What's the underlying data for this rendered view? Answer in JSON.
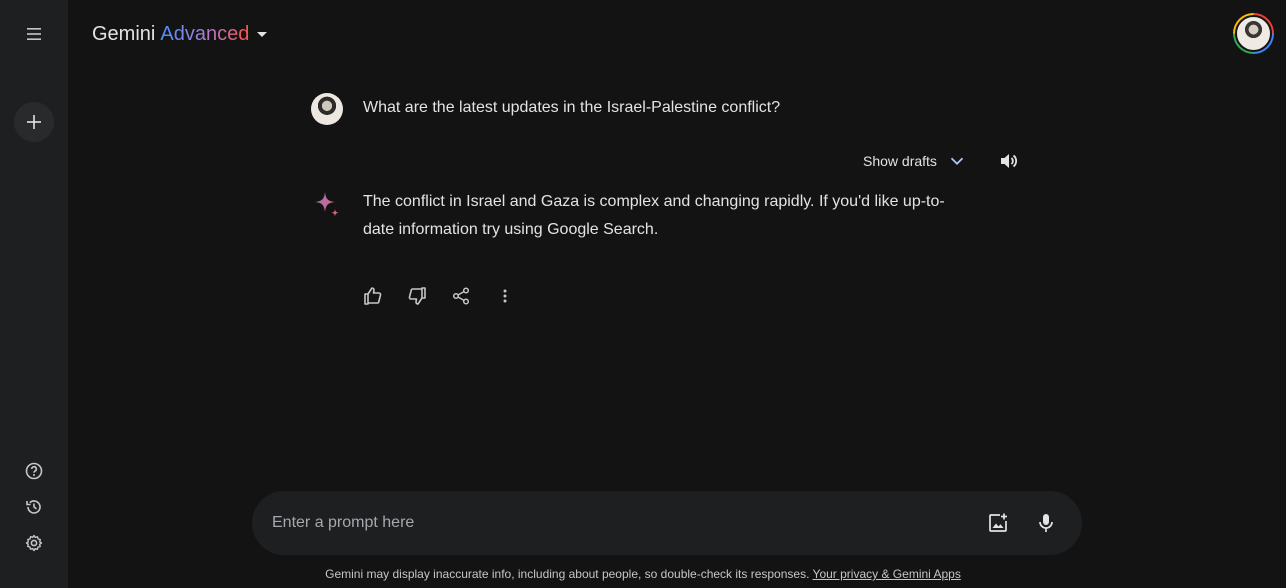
{
  "header": {
    "title_main": "Gemini",
    "title_accent": "Advanced"
  },
  "sidebar": {
    "menu_icon": "hamburger-menu-icon",
    "new_chat_icon": "plus-icon",
    "bottom_icons": [
      "help-icon",
      "history-icon",
      "settings-icon"
    ]
  },
  "conversation": {
    "user_query": "What are the latest updates in the Israel-Palestine conflict?",
    "show_drafts_label": "Show drafts",
    "response_text": "The conflict in Israel and Gaza is complex and changing rapidly. If you'd like up-to-date information try using Google Search.",
    "action_icons": [
      "thumbs-up-icon",
      "thumbs-down-icon",
      "share-icon",
      "more-vert-icon"
    ]
  },
  "prompt": {
    "placeholder": "Enter a prompt here"
  },
  "footer": {
    "disclaimer": "Gemini may display inaccurate info, including about people, so double-check its responses.",
    "privacy_link": "Your privacy & Gemini Apps"
  },
  "colors": {
    "background": "#131314",
    "sidebar": "#1e1f20",
    "text": "#e3e3e3",
    "accent_blue": "#4b90ff",
    "accent_red": "#ff5546"
  }
}
